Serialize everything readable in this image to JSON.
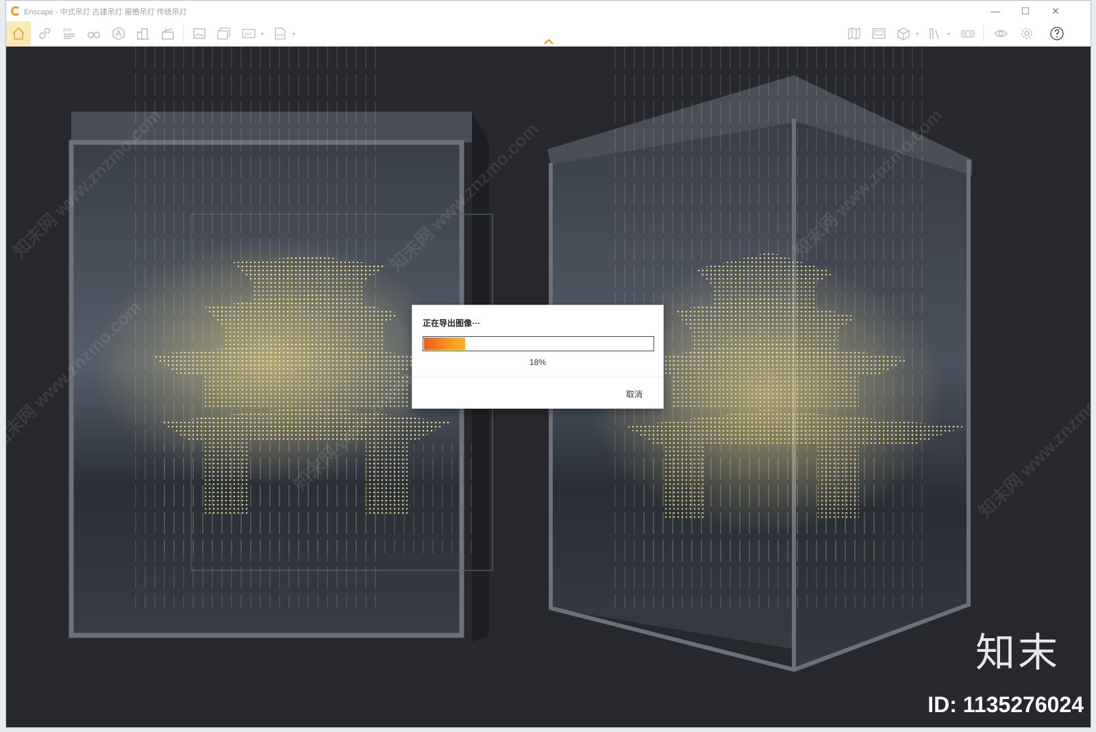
{
  "window": {
    "app_name": "Enscape",
    "title": "Enscape - 中式吊灯 古建吊灯 屋檐吊灯 传统吊灯"
  },
  "controls": {
    "minimize": "—",
    "maximize": "☐",
    "close": "✕"
  },
  "toolbar": {
    "left_icons": [
      "home-icon",
      "map-pin-icon",
      "bim-icon",
      "binoculars-icon",
      "asset-icon",
      "buildings-icon",
      "clapper-icon",
      "screenshot-icon",
      "batch-render-icon",
      "panorama-icon",
      "export-icon"
    ],
    "bim_label": "BIM",
    "pano_label": "360°",
    "exe_label": "EXE",
    "right_icons": [
      "map-icon",
      "video-editor-icon",
      "cube-icon",
      "book-icon",
      "vr-headset-icon",
      "eye-icon",
      "settings-icon",
      "help-icon"
    ]
  },
  "dialog": {
    "title": "正在导出图像···",
    "progress_value": 0.18,
    "progress_label": "18%",
    "cancel_label": "取消"
  },
  "overlay": {
    "logo_text": "知末",
    "id_text": "ID: 1135276024",
    "watermark_text": "知末网 www.znzmo.com"
  },
  "colors": {
    "accent": "#f29a1c",
    "viewport_bg": "#26282d",
    "lamp_glow": "#f3e08a"
  }
}
